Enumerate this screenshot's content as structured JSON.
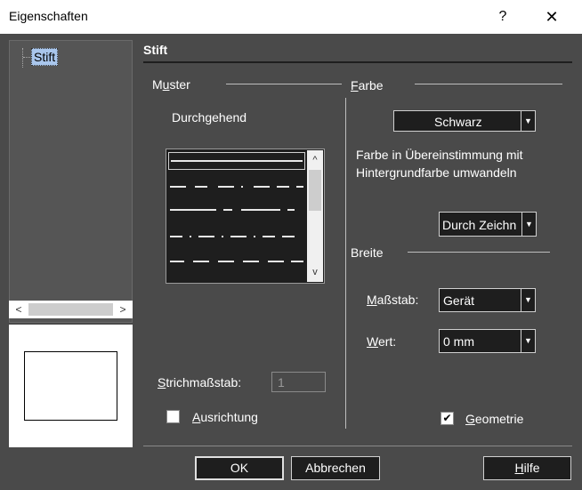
{
  "window": {
    "title": "Eigenschaften",
    "help_glyph": "?",
    "close_glyph": "✕"
  },
  "tree": {
    "items": [
      {
        "label": "Stift"
      }
    ]
  },
  "section_title": "Stift",
  "muster": {
    "label_prefix": "M",
    "label_under": "u",
    "label_rest": "ster",
    "current": "Durchgehend"
  },
  "farbe": {
    "label_under": "F",
    "label_rest": "arbe",
    "color_value": "Schwarz",
    "hint_line1": "Farbe in Übereinstimmung mit",
    "hint_line2": "Hintergrundfarbe umwandeln",
    "mode_value": "Durch Zeichn"
  },
  "breite": {
    "label": "Breite",
    "massstab_under": "M",
    "massstab_rest": "aßstab:",
    "massstab_value": "Gerät",
    "wert_under": "W",
    "wert_rest": "ert:",
    "wert_value": "0 mm"
  },
  "strichmassstab": {
    "label_under": "S",
    "label_rest": "trichmaßstab:",
    "value": "1"
  },
  "ausrichtung": {
    "label_under": "A",
    "label_rest": "usrichtung",
    "checked": false
  },
  "geometrie": {
    "label_under": "G",
    "label_rest": "eometrie",
    "checked": true,
    "check_glyph": "✔"
  },
  "buttons": {
    "ok": "OK",
    "cancel": "Abbrechen",
    "help_under": "H",
    "help_rest": "ilfe"
  },
  "scroll_glyphs": {
    "left": "<",
    "right": ">",
    "up": "^",
    "down": "v",
    "dropdown": "▼"
  }
}
